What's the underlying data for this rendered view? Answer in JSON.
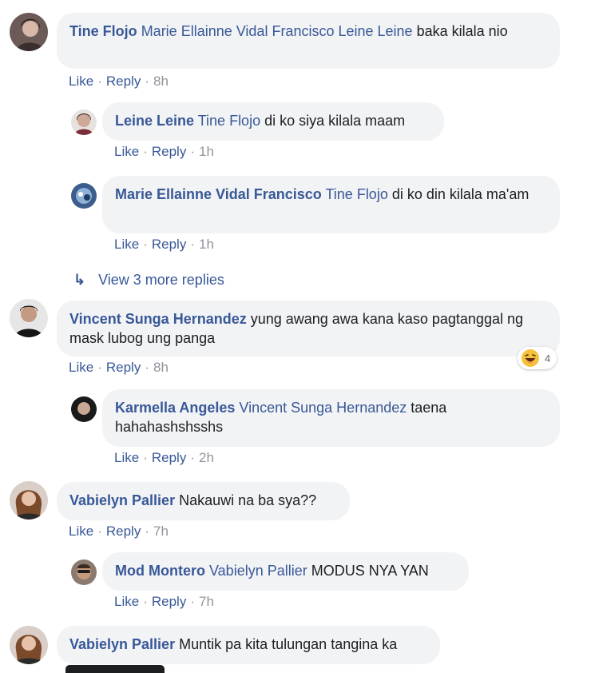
{
  "comments": [
    {
      "author": "Tine Flojo",
      "mention": "Marie Ellainne Vidal Francisco Leine Leine",
      "text": " baka kilala nio",
      "like": "Like",
      "reply": "Reply",
      "time": "8h"
    },
    {
      "author": "Leine Leine",
      "mention": "Tine Flojo",
      "text": " di ko siya kilala maam",
      "like": "Like",
      "reply": "Reply",
      "time": "1h"
    },
    {
      "author": "Marie Ellainne Vidal Francisco",
      "mention": "Tine Flojo",
      "text": " di ko din kilala ma'am",
      "like": "Like",
      "reply": "Reply",
      "time": "1h"
    },
    {
      "author": "Vincent Sunga Hernandez",
      "mention": "",
      "text": " yung awang awa kana kaso pagtanggal ng mask lubog ung panga",
      "like": "Like",
      "reply": "Reply",
      "time": "8h",
      "reaction_count": "4"
    },
    {
      "author": "Karmella Angeles",
      "mention": "Vincent Sunga Hernandez",
      "text": " taena hahahashshsshs",
      "like": "Like",
      "reply": "Reply",
      "time": "2h"
    },
    {
      "author": "Vabielyn Pallier",
      "mention": "",
      "text": " Nakauwi na ba sya??",
      "like": "Like",
      "reply": "Reply",
      "time": "7h"
    },
    {
      "author": "Mod Montero",
      "mention": "Vabielyn Pallier",
      "text": " MODUS NYA YAN",
      "like": "Like",
      "reply": "Reply",
      "time": "7h"
    },
    {
      "author": "Vabielyn Pallier",
      "mention": "",
      "text": " Muntik pa kita tulungan tangina ka"
    }
  ],
  "view_more": "View 3 more replies",
  "colors": {
    "link": "#385898",
    "bubble": "#f2f3f5",
    "muted": "#90949c"
  }
}
